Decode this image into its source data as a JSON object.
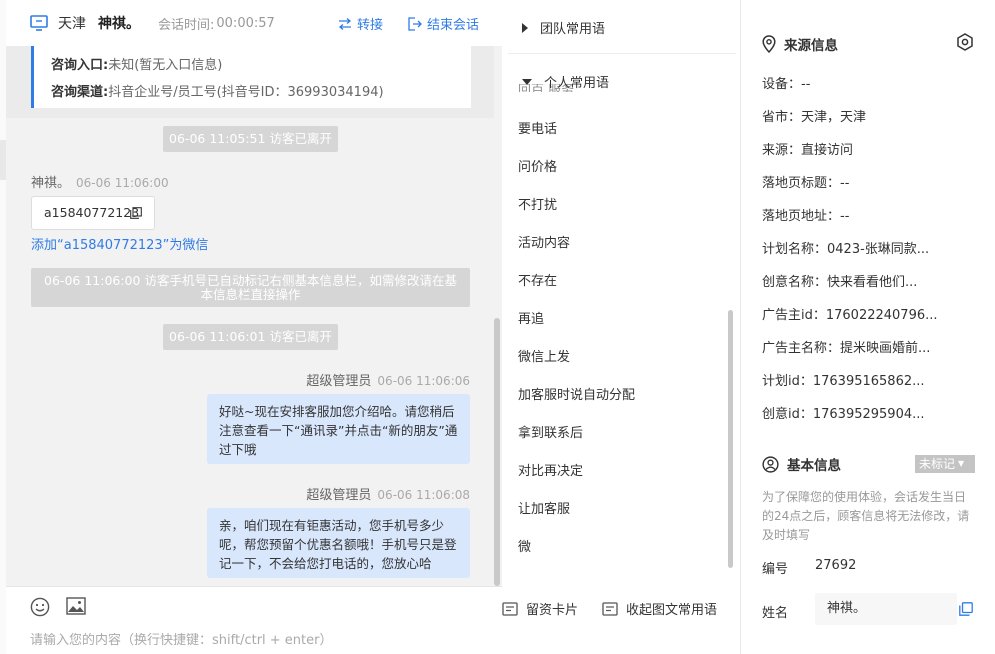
{
  "header": {
    "city": "天津",
    "visitor_name": "神祺。",
    "time_label": "会话时间:",
    "time_value": "00:00:57",
    "transfer_label": "转接",
    "end_label": "结束会话",
    "accent_color": "#2f7ce6"
  },
  "info_card": {
    "entry_label": "咨询入口:",
    "entry_value": "未知(暂无入口信息)",
    "channel_label": "咨询渠道:",
    "channel_value": "抖音企业号/员工号(抖音号ID：36993034194)"
  },
  "messages": {
    "sys1": "06-06 11:05:51 访客已离开",
    "visitor_name": "神祺。",
    "visitor_time": "06-06 11:06:00",
    "visitor_code": "a15840772123",
    "add_wechat": "添加“a15840772123”为微信",
    "sys2": "06-06 11:06:00 访客手机号已自动标记右侧基本信息栏，如需修改请在基本信息栏直接操作",
    "sys3": "06-06 11:06:01 访客已离开",
    "agent_name": "超级管理员",
    "agent_time1": "06-06 11:06:06",
    "agent_msg1": "好哒~现在安排客服加您介绍哈。请您稍后注意查看一下“通讯录”并点击“新的朋友”通过下哦",
    "agent_time2": "06-06 11:06:08",
    "agent_msg2": "亲，咱们现在有钜惠活动，您手机号多少呢，帮您预留个优惠名额哦！手机号只是登记一下，不会给您打电话的，您放心哈"
  },
  "composer": {
    "placeholder": "请输入您的内容（换行快捷键：shift/ctrl + enter）",
    "emoji_icon": "emoji-icon",
    "image_icon": "image-icon"
  },
  "phrases": {
    "team_group": "团队常用语",
    "personal_group": "个人常用语",
    "ghost": "回百 服务",
    "items": [
      "要电话",
      "问价格",
      "不打扰",
      "活动内容",
      "不存在",
      "再追",
      "微信上发",
      "加客服时说自动分配",
      "拿到联系后",
      "对比再决定",
      "让加客服",
      "微"
    ],
    "card_btn": "留资卡片",
    "collapse_btn": "收起图文常用语"
  },
  "source_info": {
    "title": "来源信息",
    "device": "设备：--",
    "region": "省市：天津，天津",
    "source": "来源：直接访问",
    "landing_title": "落地页标题：--",
    "landing_url": "落地页地址：--",
    "plan_name": "计划名称：0423-张琳同款...",
    "creative_name": "创意名称：快来看看他们...",
    "advertiser_id": "广告主id：176022240796...",
    "advertiser_name": "广告主名称：提米映画婚前...",
    "plan_id": "计划id：176395165862...",
    "creative_id": "创意id：176395295904..."
  },
  "basic_info": {
    "title": "基本信息",
    "tag": "未标记",
    "notice": "为了保障您的使用体验，会话发生当日的24点之后，顾客信息将无法修改，请及时填写",
    "id_label": "编号",
    "id_value": "27692",
    "name_label": "姓名",
    "name_value": "神祺。"
  }
}
